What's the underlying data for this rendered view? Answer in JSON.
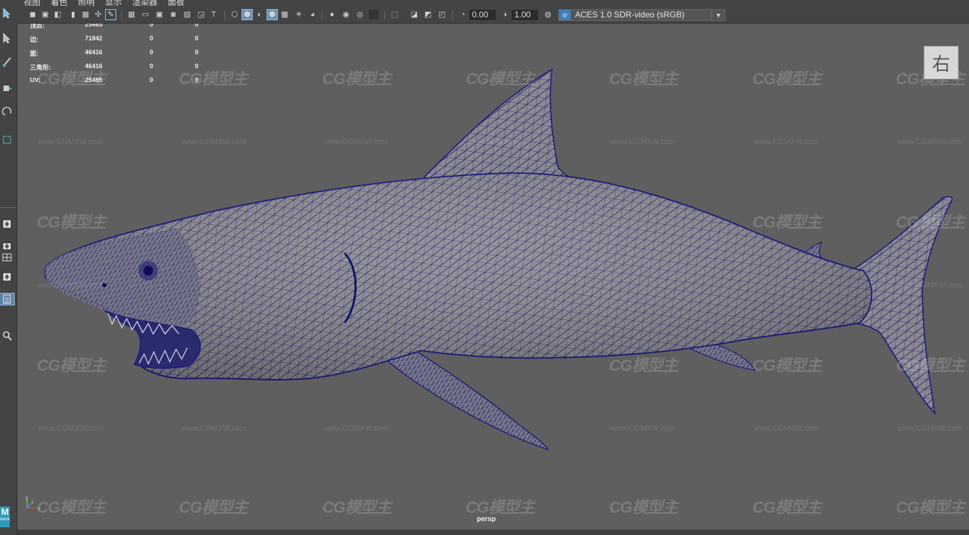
{
  "menu": {
    "items": [
      "视图",
      "着色",
      "照明",
      "显示",
      "渲染器",
      "面板"
    ]
  },
  "toolbar": {
    "camera_exposure": "0.00",
    "camera_gamma": "1.00",
    "color_space": "ACES 1.0 SDR-video (sRGB)"
  },
  "hud": {
    "stats": [
      {
        "label": "顶点:",
        "value": "25485",
        "sel": "0",
        "comp": "0"
      },
      {
        "label": "边:",
        "value": "71842",
        "sel": "0",
        "comp": "0"
      },
      {
        "label": "面:",
        "value": "46416",
        "sel": "0",
        "comp": "0"
      },
      {
        "label": "三角形:",
        "value": "46416",
        "sel": "0",
        "comp": "0"
      },
      {
        "label": "UV:",
        "value": "25485",
        "sel": "0",
        "comp": "0"
      }
    ]
  },
  "viewport": {
    "camera_name": "persp",
    "view_cube_face": "右",
    "wireframe_color": "#1b1b7a",
    "background_color": "#5f5f5f"
  },
  "watermark": {
    "logo": "CG模型主",
    "url": "www.CGMXW.com"
  },
  "axis": {
    "x": "x",
    "y": "y",
    "z": "z"
  },
  "logo": {
    "letter": "M",
    "sub": "MAYA"
  },
  "colors": {
    "accent": "#3d7fb8",
    "toolbar_bg": "#444444",
    "highlight": "#6a8fb0"
  }
}
